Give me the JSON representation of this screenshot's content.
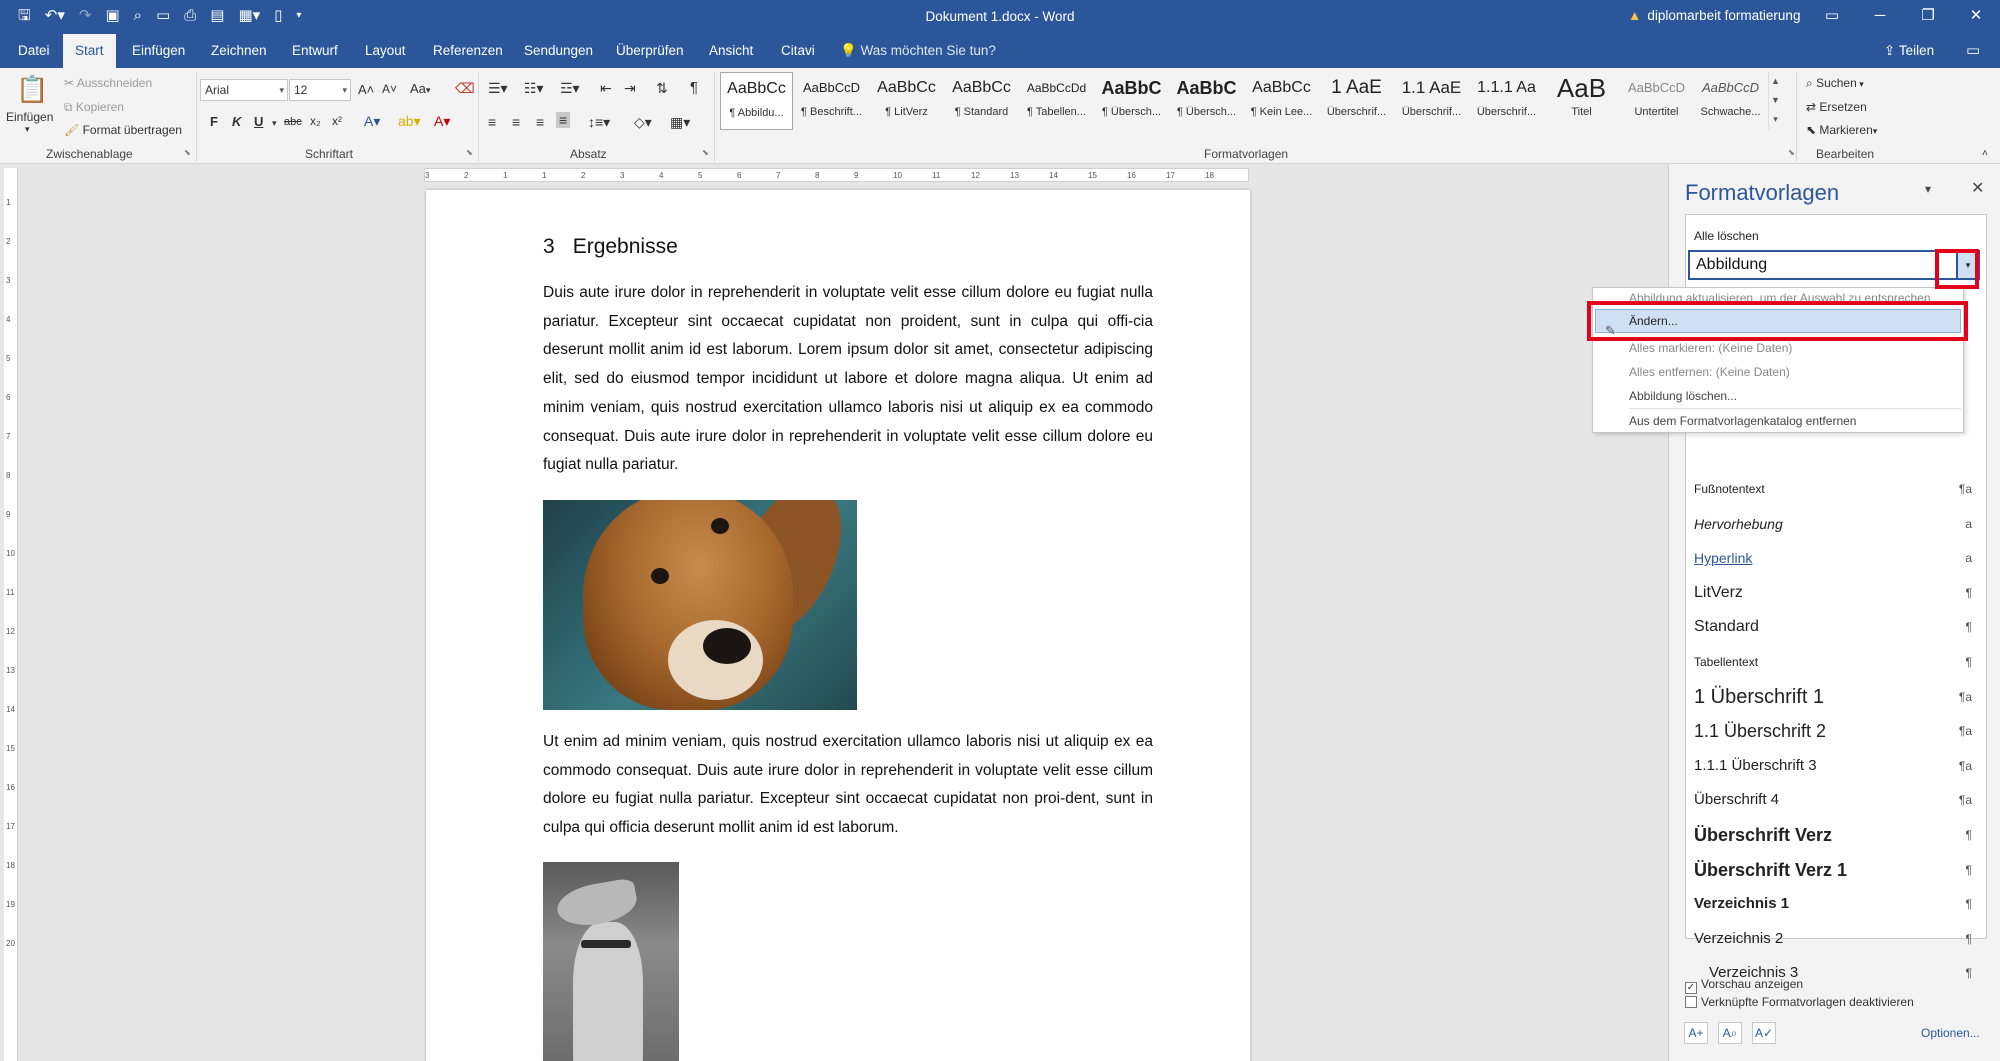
{
  "window": {
    "title": "Dokument 1.docx  -  Word",
    "warning": "diplomarbeit formatierung",
    "qat_icons": [
      "save-icon",
      "undo-icon",
      "redo-icon",
      "save-as-icon",
      "print-preview-icon",
      "open-icon",
      "print-icon",
      "layout-icon",
      "table-icon",
      "new-doc-icon",
      "customize-icon"
    ]
  },
  "tabs": {
    "items": [
      "Datei",
      "Start",
      "Einfügen",
      "Zeichnen",
      "Entwurf",
      "Layout",
      "Referenzen",
      "Sendungen",
      "Überprüfen",
      "Ansicht",
      "Citavi"
    ],
    "active": "Start",
    "tell_me": "Was möchten Sie tun?",
    "share": "Teilen"
  },
  "ribbon": {
    "clipboard": {
      "label": "Zwischenablage",
      "paste": "Einfügen",
      "cut": "Ausschneiden",
      "copy": "Kopieren",
      "format_painter": "Format übertragen"
    },
    "font": {
      "label": "Schriftart",
      "name": "Arial",
      "size": "12",
      "bold": "F",
      "italic": "K",
      "underline": "U",
      "strike": "abc",
      "sub": "x₂",
      "sup": "x²",
      "case": "Aa"
    },
    "paragraph": {
      "label": "Absatz"
    },
    "styles": {
      "label": "Formatvorlagen",
      "tiles": [
        {
          "preview": "AaBbCc",
          "name": "¶ Abbildu..."
        },
        {
          "preview": "AaBbCcD",
          "name": "¶ Beschrift..."
        },
        {
          "preview": "AaBbCc",
          "name": "¶ LitVerz"
        },
        {
          "preview": "AaBbCc",
          "name": "¶ Standard"
        },
        {
          "preview": "AaBbCcDd",
          "name": "¶ Tabellen..."
        },
        {
          "preview": "AaBbC",
          "name": "¶ Übersch..."
        },
        {
          "preview": "AaBbC",
          "name": "¶ Übersch..."
        },
        {
          "preview": "AaBbCc",
          "name": "¶ Kein Lee..."
        },
        {
          "preview": "1 AaE",
          "name": "Überschrif..."
        },
        {
          "preview": "1.1 AaE",
          "name": "Überschrif..."
        },
        {
          "preview": "1.1.1 Aa",
          "name": "Überschrif..."
        },
        {
          "preview": "AaB",
          "name": "Titel"
        },
        {
          "preview": "AaBbCcD",
          "name": "Untertitel"
        },
        {
          "preview": "AaBbCcD",
          "name": "Schwache..."
        }
      ]
    },
    "editing": {
      "label": "Bearbeiten",
      "find": "Suchen",
      "replace": "Ersetzen",
      "select": "Markieren"
    }
  },
  "document": {
    "heading_number": "3",
    "heading_text": "Ergebnisse",
    "para1": "Duis aute irure dolor in reprehenderit in voluptate velit esse cillum dolore eu fugiat nulla pariatur. Excepteur sint occaecat cupidatat non proident, sunt in culpa qui offi-cia deserunt mollit anim id est laborum. Lorem ipsum dolor sit amet, consectetur adipiscing elit, sed do eiusmod tempor incididunt ut labore et dolore magna aliqua. Ut enim ad minim veniam, quis nostrud exercitation ullamco laboris nisi ut aliquip ex ea commodo consequat. Duis aute irure dolor in reprehenderit in voluptate velit esse cillum dolore eu fugiat nulla pariatur.",
    "para2": "Ut enim ad minim veniam, quis nostrud exercitation ullamco laboris nisi ut aliquip ex ea commodo consequat. Duis aute irure dolor in reprehenderit in voluptate velit esse cillum dolore eu fugiat nulla pariatur. Excepteur sint occaecat cupidatat non proi-dent, sunt in culpa qui officia deserunt mollit anim id est laborum."
  },
  "ruler": {
    "h_ticks": [
      "3",
      "2",
      "1",
      "1",
      "2",
      "3",
      "4",
      "5",
      "6",
      "7",
      "8",
      "9",
      "10",
      "11",
      "12",
      "13",
      "14",
      "15",
      "16",
      "17",
      "18"
    ],
    "v_ticks": [
      "1",
      "2",
      "3",
      "4",
      "5",
      "6",
      "7",
      "8",
      "9",
      "10",
      "11",
      "12",
      "13",
      "14",
      "15",
      "16",
      "17",
      "18",
      "19",
      "20"
    ]
  },
  "pane": {
    "title": "Formatvorlagen",
    "clear_all": "Alle löschen",
    "current_style": "Abbildung",
    "styles": [
      {
        "name": "Fußnotentext",
        "mark": "¶a"
      },
      {
        "name": "Hervorhebung",
        "mark": "a"
      },
      {
        "name": "Hyperlink",
        "mark": "a"
      },
      {
        "name": "LitVerz",
        "mark": "¶"
      },
      {
        "name": "Standard",
        "mark": "¶"
      },
      {
        "name": "Tabellentext",
        "mark": "¶"
      },
      {
        "name": "1  Überschrift 1",
        "mark": "¶a"
      },
      {
        "name": "1.1  Überschrift 2",
        "mark": "¶a"
      },
      {
        "name": "1.1.1  Überschrift 3",
        "mark": "¶a"
      },
      {
        "name": "Überschrift 4",
        "mark": "¶a"
      },
      {
        "name": "Überschrift Verz",
        "mark": "¶"
      },
      {
        "name": "Überschrift Verz 1",
        "mark": "¶"
      },
      {
        "name": "Verzeichnis 1",
        "mark": "¶"
      },
      {
        "name": "Verzeichnis 2",
        "mark": "¶"
      },
      {
        "name": "Verzeichnis 3",
        "mark": "¶"
      }
    ],
    "show_preview": "Vorschau anzeigen",
    "disable_linked": "Verknüpfte Formatvorlagen deaktivieren",
    "options": "Optionen..."
  },
  "context_menu": {
    "update": "Abbildung aktualisieren, um der Auswahl zu entsprechen",
    "modify": "Ändern...",
    "select_all": "Alles markieren: (Keine Daten)",
    "remove_all": "Alles entfernen: (Keine Daten)",
    "delete": "Abbildung löschen...",
    "remove_gallery": "Aus dem Formatvorlagenkatalog entfernen"
  },
  "colors": {
    "accent": "#2b579a",
    "highlight": "#e4001b"
  }
}
